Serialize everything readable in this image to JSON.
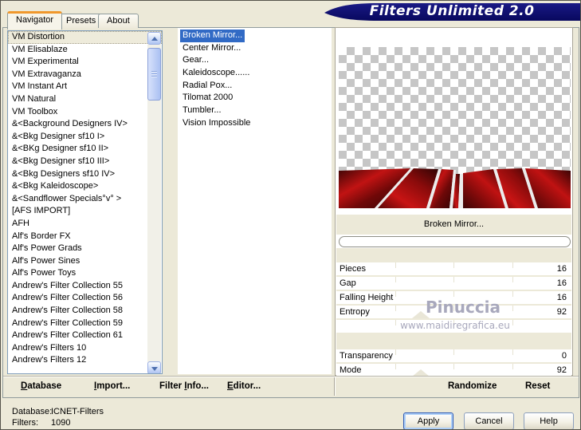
{
  "window": {
    "title": "Filters Unlimited 2.0"
  },
  "tabs": [
    {
      "label": "Navigator",
      "active": true
    },
    {
      "label": "Presets",
      "active": false
    },
    {
      "label": "About",
      "active": false
    }
  ],
  "left_list": {
    "items": [
      "VM Distortion",
      "VM Elisablaze",
      "VM Experimental",
      "VM Extravaganza",
      "VM Instant Art",
      "VM Natural",
      "VM Toolbox",
      "&<Background Designers IV>",
      "&<Bkg Designer sf10 I>",
      "&<BKg Designer sf10 II>",
      "&<Bkg Designer sf10 III>",
      "&<Bkg Designers sf10 IV>",
      "&<Bkg Kaleidoscope>",
      "&<Sandflower Specials°v° >",
      "[AFS IMPORT]",
      "AFH",
      "Alf's Border FX",
      "Alf's Power Grads",
      "Alf's Power Sines",
      "Alf's Power Toys",
      "Andrew's Filter Collection 55",
      "Andrew's Filter Collection 56",
      "Andrew's Filter Collection 58",
      "Andrew's Filter Collection 59",
      "Andrew's Filter Collection 61",
      "Andrew's Filters 10",
      "Andrew's Filters 12"
    ],
    "selected": "VM Distortion"
  },
  "filter_list": {
    "items": [
      "Broken Mirror...",
      "Center Mirror...",
      "Gear...",
      "Kaleidoscope......",
      "Radial Pox...",
      "Tilomat 2000",
      "Tumbler...",
      "Vision Impossible"
    ],
    "selected": "Broken Mirror..."
  },
  "preview": {
    "caption": "Broken Mirror..."
  },
  "params": {
    "rows": [
      {
        "label": "Pieces",
        "value": "16"
      },
      {
        "label": "Gap",
        "value": "16"
      },
      {
        "label": "Falling Height",
        "value": "16"
      },
      {
        "label": "Entropy",
        "value": "92"
      },
      {
        "label": "",
        "value": ""
      },
      {
        "label": "Transparency",
        "value": "0"
      },
      {
        "label": "Mode",
        "value": "92"
      }
    ]
  },
  "watermark": {
    "line1": "Pinuccia",
    "line2": "www.maidiregrafica.eu"
  },
  "toolbar": {
    "database": {
      "pre": "",
      "u": "D",
      "post": "atabase"
    },
    "import": {
      "pre": "",
      "u": "I",
      "post": "mport..."
    },
    "filter_info": {
      "pre": "Filter ",
      "u": "I",
      "post": "nfo..."
    },
    "editor": {
      "pre": "",
      "u": "E",
      "post": "ditor..."
    },
    "randomize": "Randomize",
    "reset": "Reset"
  },
  "status": {
    "database_label": "Database:",
    "database_value": "ICNET-Filters",
    "filters_label": "Filters:",
    "filters_value": "1090"
  },
  "buttons": {
    "apply": "Apply",
    "cancel": "Cancel",
    "help": "Help"
  },
  "colors": {
    "banner_navy": "#0c0c6e",
    "selection_blue": "#316ac5",
    "tab_accent_orange": "#f0982c",
    "dialog_beige": "#ece9d8",
    "preview_red": "#c01212",
    "watermark_grey": "#a8a8bc"
  }
}
